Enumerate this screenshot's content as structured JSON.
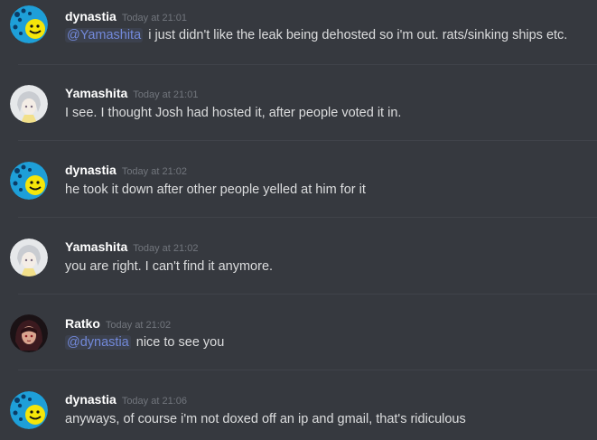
{
  "messages": [
    {
      "author": "dynastia",
      "timestamp": "Today at 21:01",
      "mention": "@Yamashita",
      "text": "i just didn't like the leak being dehosted so i'm out. rats/sinking ships etc.",
      "avatar_icon": "dynastia-avatar-icon"
    },
    {
      "author": "Yamashita",
      "timestamp": "Today at 21:01",
      "text": "I see. I thought Josh had hosted it, after people voted it in.",
      "avatar_icon": "yamashita-avatar-icon"
    },
    {
      "author": "dynastia",
      "timestamp": "Today at 21:02",
      "text": "he took it down after other people yelled at him for it",
      "avatar_icon": "dynastia-avatar-icon"
    },
    {
      "author": "Yamashita",
      "timestamp": "Today at 21:02",
      "text": "you are right. I can't find it anymore.",
      "avatar_icon": "yamashita-avatar-icon"
    },
    {
      "author": "Ratko",
      "timestamp": "Today at 21:02",
      "mention": "@dynastia",
      "text": "nice to see you",
      "avatar_icon": "ratko-avatar-icon"
    },
    {
      "author": "dynastia",
      "timestamp": "Today at 21:06",
      "text": "anyways, of course i'm not doxed off an ip and gmail, that's ridiculous",
      "avatar_icon": "dynastia-avatar-icon"
    }
  ],
  "colors": {
    "background": "#36393f",
    "username": "#ffffff",
    "timestamp": "#72767d",
    "message_text": "#dcddde",
    "mention": "#7289da",
    "divider": "#40434a"
  }
}
